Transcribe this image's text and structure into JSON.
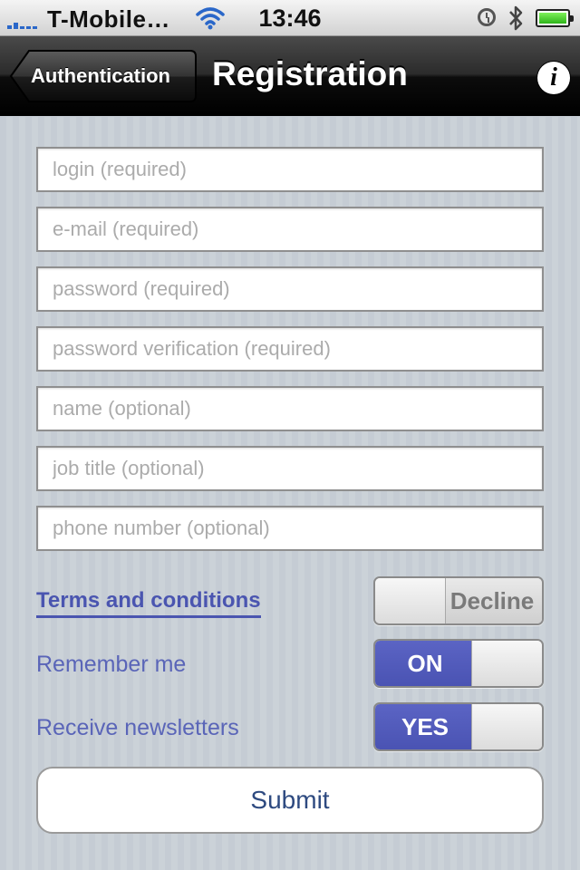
{
  "status_bar": {
    "carrier": "T-Mobile…",
    "time": "13:46"
  },
  "nav": {
    "back_label": "Authentication",
    "title": "Registration",
    "info_glyph": "i"
  },
  "form": {
    "fields": [
      {
        "name": "login-field",
        "placeholder": "login (required)",
        "value": ""
      },
      {
        "name": "email-field",
        "placeholder": "e-mail (required)",
        "value": ""
      },
      {
        "name": "password-field",
        "placeholder": "password (required)",
        "value": ""
      },
      {
        "name": "password-verification-field",
        "placeholder": "password verification (required)",
        "value": ""
      },
      {
        "name": "name-field",
        "placeholder": "name (optional)",
        "value": ""
      },
      {
        "name": "job-title-field",
        "placeholder": "job title (optional)",
        "value": ""
      },
      {
        "name": "phone-number-field",
        "placeholder": "phone number (optional)",
        "value": ""
      }
    ],
    "terms": {
      "link_label": "Terms and conditions",
      "switch_label": "Decline",
      "switch_state": "off"
    },
    "remember": {
      "label": "Remember me",
      "switch_label": "ON",
      "switch_state": "on"
    },
    "newsletters": {
      "label": "Receive newsletters",
      "switch_label": "YES",
      "switch_state": "on"
    },
    "submit_label": "Submit"
  },
  "colors": {
    "accent": "#4a55b0",
    "switch_on": "#5059bd",
    "background": "#c5ccd4",
    "submit_text": "#2e4a80"
  }
}
